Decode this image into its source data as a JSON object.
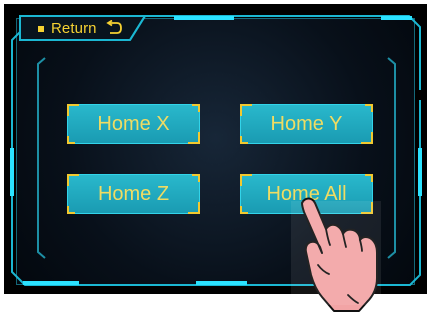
{
  "navigation": {
    "return_label": "Return",
    "return_icon": "return-arrow-icon"
  },
  "home_buttons": [
    {
      "label": "Home X"
    },
    {
      "label": "Home Y"
    },
    {
      "label": "Home Z"
    },
    {
      "label": "Home All"
    }
  ],
  "theme": {
    "frame_color": "#23b6ce",
    "button_fill": "#1fa9bf",
    "label_color": "#f0dc62",
    "accent_color": "#f2c92f",
    "background": "#081019"
  },
  "overlay": {
    "hand_icon": "pointing-hand-icon"
  }
}
